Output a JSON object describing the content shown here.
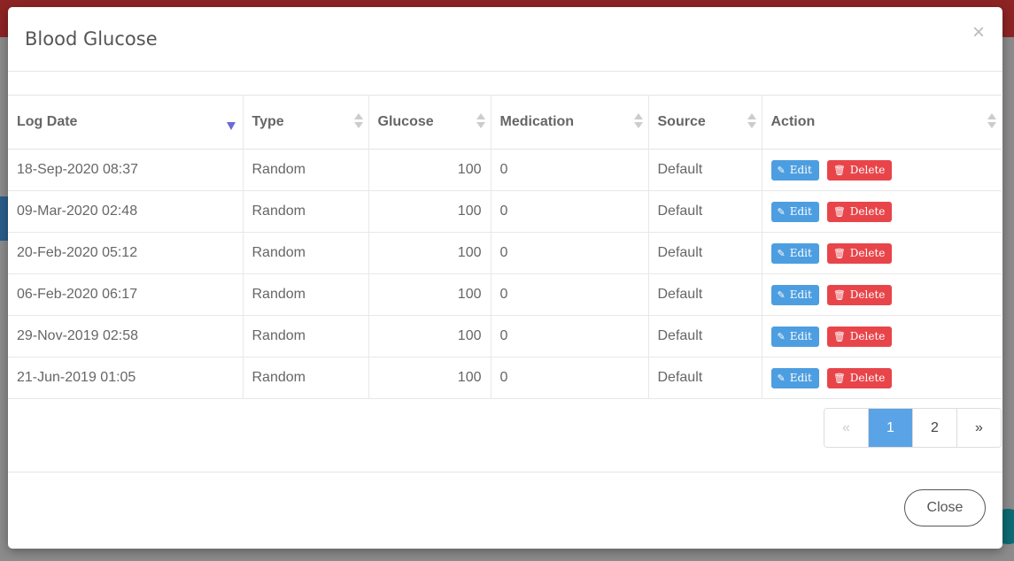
{
  "modal": {
    "title": "Blood Glucose",
    "close_symbol": "×",
    "close_button": "Close"
  },
  "table": {
    "columns": [
      "Log Date",
      "Type",
      "Glucose",
      "Medication",
      "Source",
      "Action"
    ],
    "rows": [
      {
        "log_date": "18-Sep-2020 08:37",
        "type": "Random",
        "glucose": "100",
        "medication": "0",
        "source": "Default"
      },
      {
        "log_date": "09-Mar-2020 02:48",
        "type": "Random",
        "glucose": "100",
        "medication": "0",
        "source": "Default"
      },
      {
        "log_date": "20-Feb-2020 05:12",
        "type": "Random",
        "glucose": "100",
        "medication": "0",
        "source": "Default"
      },
      {
        "log_date": "06-Feb-2020 06:17",
        "type": "Random",
        "glucose": "100",
        "medication": "0",
        "source": "Default"
      },
      {
        "log_date": "29-Nov-2019 02:58",
        "type": "Random",
        "glucose": "100",
        "medication": "0",
        "source": "Default"
      },
      {
        "log_date": "21-Jun-2019 01:05",
        "type": "Random",
        "glucose": "100",
        "medication": "0",
        "source": "Default"
      }
    ],
    "edit_label": "Edit",
    "delete_label": "Delete",
    "edit_icon": "pencil-square-icon",
    "delete_icon": "trash-icon"
  },
  "pagination": {
    "prev": "«",
    "pages": [
      "1",
      "2"
    ],
    "active_page": "1",
    "next": "»"
  },
  "colors": {
    "edit": "#4d9ee0",
    "delete": "#e8454a",
    "active_page": "#5aa3e6",
    "sort_active": "#6a6ad8"
  }
}
